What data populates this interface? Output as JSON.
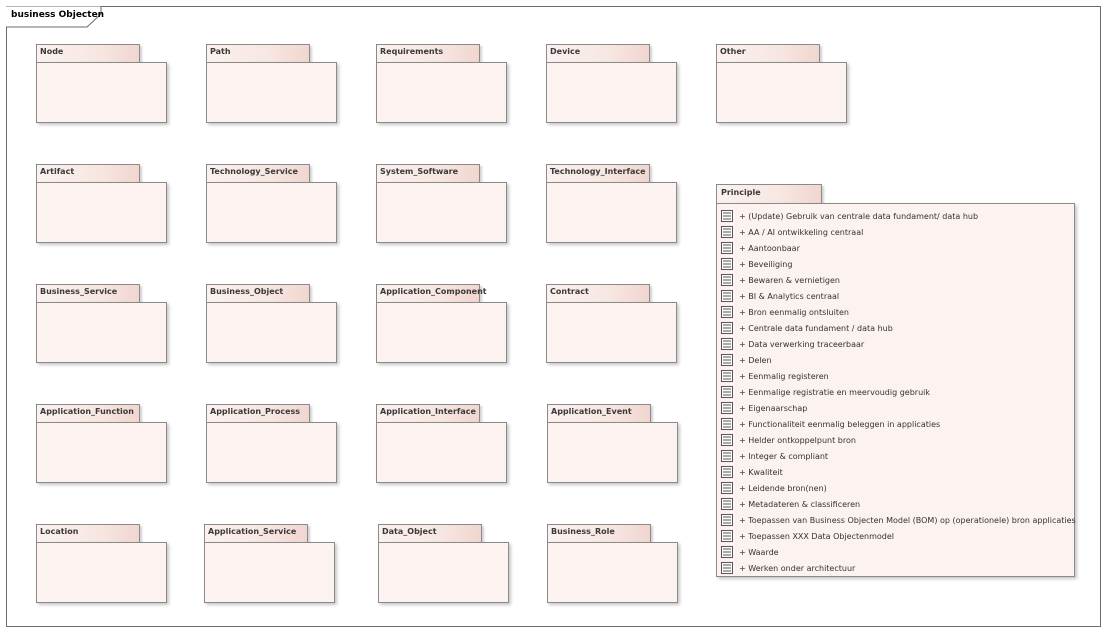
{
  "frame": {
    "title": "business Objecten"
  },
  "packages": [
    {
      "name": "Node"
    },
    {
      "name": "Path"
    },
    {
      "name": "Requirements"
    },
    {
      "name": "Device"
    },
    {
      "name": "Other"
    },
    {
      "name": "Artifact"
    },
    {
      "name": "Technology_Service"
    },
    {
      "name": "System_Software"
    },
    {
      "name": "Technology_Interface"
    },
    {
      "name": "Business_Service"
    },
    {
      "name": "Business_Object"
    },
    {
      "name": "Application_Component"
    },
    {
      "name": "Contract"
    },
    {
      "name": "Application_Function"
    },
    {
      "name": "Application_Process"
    },
    {
      "name": "Application_Interface"
    },
    {
      "name": "Application_Event"
    },
    {
      "name": "Location"
    },
    {
      "name": "Application_Service"
    },
    {
      "name": "Data_Object"
    },
    {
      "name": "Business_Role"
    }
  ],
  "principle": {
    "name": "Principle",
    "items": [
      "+ (Update) Gebruik van centrale data fundament/ data hub",
      "+ AA / AI ontwikkeling centraal",
      "+ Aantoonbaar",
      "+ Beveiliging",
      "+ Bewaren & vernietigen",
      "+ BI & Analytics centraal",
      "+ Bron eenmalig ontsluiten",
      "+ Centrale data fundament / data hub",
      "+ Data verwerking traceerbaar",
      "+ Delen",
      "+ Eenmalig registeren",
      "+ Eenmalige registratie en meervoudig gebruik",
      "+ Eigenaarschap",
      "+ Functionaliteit eenmalig beleggen in applicaties",
      "+ Helder ontkoppelpunt bron",
      "+ Integer & compliant",
      "+ Kwaliteit",
      "+ Leidende bron(nen)",
      "+ Metadateren & classificeren",
      "+ Toepassen van Business Objecten Model (BOM) op (operationele) bron applicaties",
      "+ Toepassen XXX Data Objectenmodel",
      "+ Waarde",
      "+ Werken onder architectuur"
    ]
  }
}
